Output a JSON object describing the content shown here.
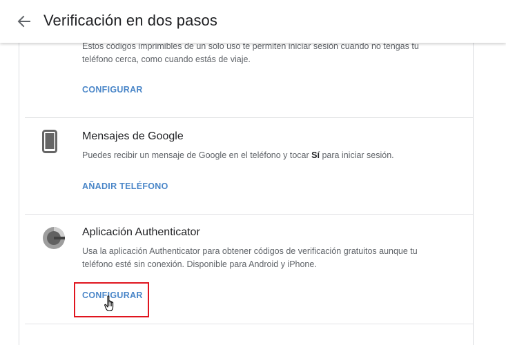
{
  "header": {
    "title": "Verificación en dos pasos",
    "back_icon": "arrow-back-icon"
  },
  "sections": {
    "backup_codes": {
      "desc_lines": [
        "Estos códigos imprimibles de un solo uso te permiten iniciar sesión cuando no tengas tu",
        "teléfono cerca, como cuando estás de viaje."
      ],
      "action": "CONFIGURAR"
    },
    "google_prompt": {
      "icon": "phone-icon",
      "title": "Mensajes de Google",
      "desc_before": "Puedes recibir un mensaje de Google en el teléfono y tocar ",
      "desc_bold": "Sí",
      "desc_after": " para iniciar sesión.",
      "action": "AÑADIR TELÉFONO"
    },
    "authenticator": {
      "icon": "authenticator-icon",
      "title": "Aplicación Authenticator",
      "desc_lines": [
        "Usa la aplicación Authenticator para obtener códigos de verificación gratuitos aunque tu",
        "teléfono esté sin conexión. Disponible para Android y iPhone."
      ],
      "action": "CONFIGURAR"
    }
  },
  "colors": {
    "link": "#4a86c8",
    "highlight_box": "#e0141e"
  }
}
